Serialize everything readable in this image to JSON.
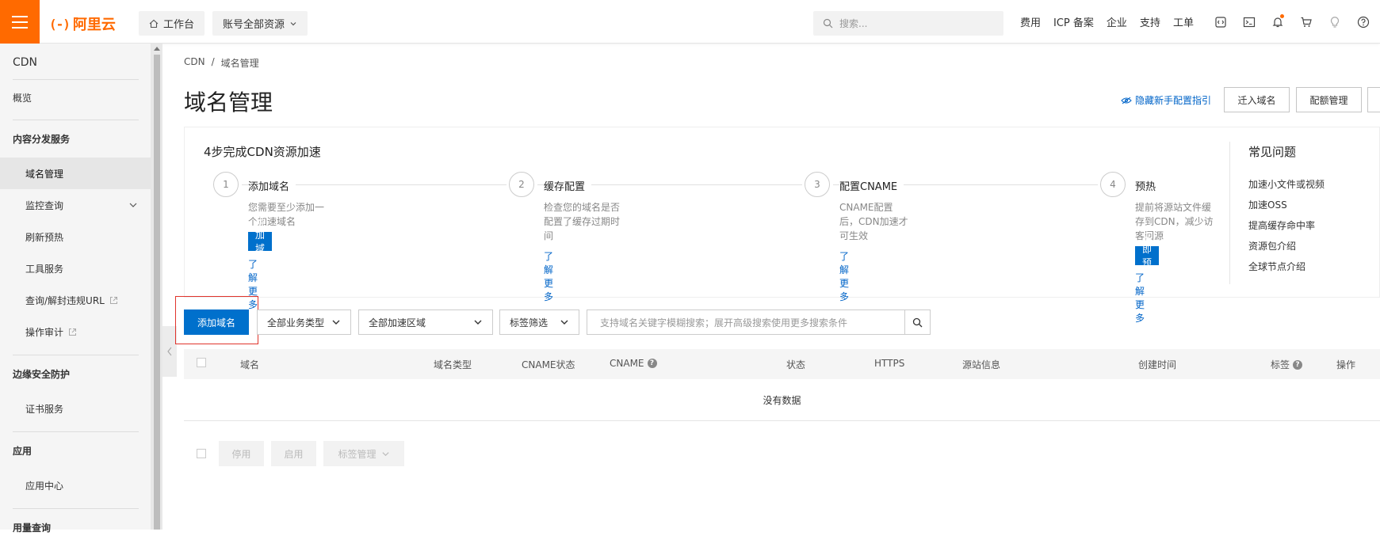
{
  "topbar": {
    "logo_text": "阿里云",
    "logo_mark": "(-)",
    "workbench_label": "工作台",
    "resource_scope_label": "账号全部资源",
    "search_placeholder": "搜索...",
    "links": [
      "费用",
      "ICP 备案",
      "企业",
      "支持",
      "工单"
    ],
    "brand_color": "#ff6a00"
  },
  "sidebar": {
    "title": "CDN",
    "overview": "概览",
    "section_content": "内容分发服务",
    "domain_mgmt": "域名管理",
    "monitor_query": "监控查询",
    "refresh_preheat": "刷新预热",
    "tool_service": "工具服务",
    "query_unblock_url": "查询/解封违规URL",
    "audit": "操作审计",
    "section_edge": "边缘安全防护",
    "cert_service": "证书服务",
    "section_app": "应用",
    "app_center": "应用中心",
    "section_cut": "用量查询"
  },
  "breadcrumb": {
    "root": "CDN",
    "sep": "/",
    "current": "域名管理"
  },
  "page": {
    "title": "域名管理",
    "hide_guide": "隐藏新手配置指引",
    "migrate_btn": "迁入域名",
    "quota_btn": "配额管理"
  },
  "guide": {
    "title": "4步完成CDN资源加速",
    "steps": [
      {
        "num": "1",
        "label": "添加域名",
        "desc": "您需要至少添加一个加速域名",
        "cta": "添加域名",
        "more": "了解更多"
      },
      {
        "num": "2",
        "label": "缓存配置",
        "desc": "检查您的域名是否配置了缓存过期时间",
        "more": "了解更多"
      },
      {
        "num": "3",
        "label": "配置CNAME",
        "desc": "CNAME配置后，CDN加速才可生效",
        "more": "了解更多"
      },
      {
        "num": "4",
        "label": "预热",
        "desc": "提前将源站文件缓存到CDN，减少访客回源",
        "cta": "立即预热",
        "more": "了解更多"
      }
    ],
    "faq_title": "常见问题",
    "faq": [
      "加速小文件或视频",
      "加速OSS",
      "提高缓存命中率",
      "资源包介绍",
      "全球节点介绍"
    ]
  },
  "toolbar": {
    "add_domain": "添加域名",
    "business_type": "全部业务类型",
    "region": "全部加速区域",
    "tag_filter": "标签筛选",
    "search_placeholder": "支持域名关键字模糊搜索；展开高级搜索使用更多搜索条件"
  },
  "table": {
    "columns": [
      "域名",
      "域名类型",
      "CNAME状态",
      "CNAME",
      "状态",
      "HTTPS",
      "源站信息",
      "创建时间",
      "标签",
      "操作"
    ],
    "empty_text": "没有数据"
  },
  "batch": {
    "disable": "停用",
    "enable": "启用",
    "tag_mgmt": "标签管理"
  },
  "colors": {
    "primary_blue": "#0070cc",
    "link_blue": "#0064c8",
    "highlight_red": "#e0342c"
  }
}
